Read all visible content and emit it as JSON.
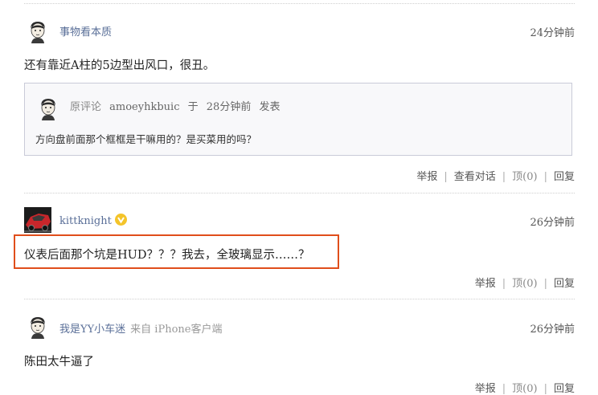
{
  "comments": [
    {
      "username": "事物看本质",
      "time": "24分钟前",
      "text": "还有靠近A柱的5边型出风口，很丑。",
      "quote": {
        "label": "原评论",
        "author": "amoeyhkbuic",
        "at": "于",
        "time": "28分钟前",
        "action": "发表",
        "text": "方向盘前面那个框框是干嘛用的？是买菜用的吗？"
      },
      "actions": {
        "report": "举报",
        "view_thread": "查看对话",
        "upvote": "顶(0)",
        "reply": "回复"
      }
    },
    {
      "username": "kittknight",
      "time": "26分钟前",
      "text": "仪表后面那个坑是HUD？？？我去，全玻璃显示……？",
      "actions": {
        "report": "举报",
        "upvote": "顶(0)",
        "reply": "回复"
      }
    },
    {
      "username": "我是YY小车迷",
      "source": "来自 iPhone客户端",
      "time": "26分钟前",
      "text": "陈田太牛逼了",
      "actions": {
        "report": "举报",
        "upvote": "顶(0)",
        "reply": "回复"
      }
    }
  ],
  "colors": {
    "accent_highlight": "#e04e1b",
    "username": "#5a6f98",
    "badge": "#f4c42a"
  },
  "icons": {
    "avatar": "cartoon-avatar-icon",
    "car_avatar": "red-car-avatar-icon",
    "badge": "verified-badge-icon"
  }
}
